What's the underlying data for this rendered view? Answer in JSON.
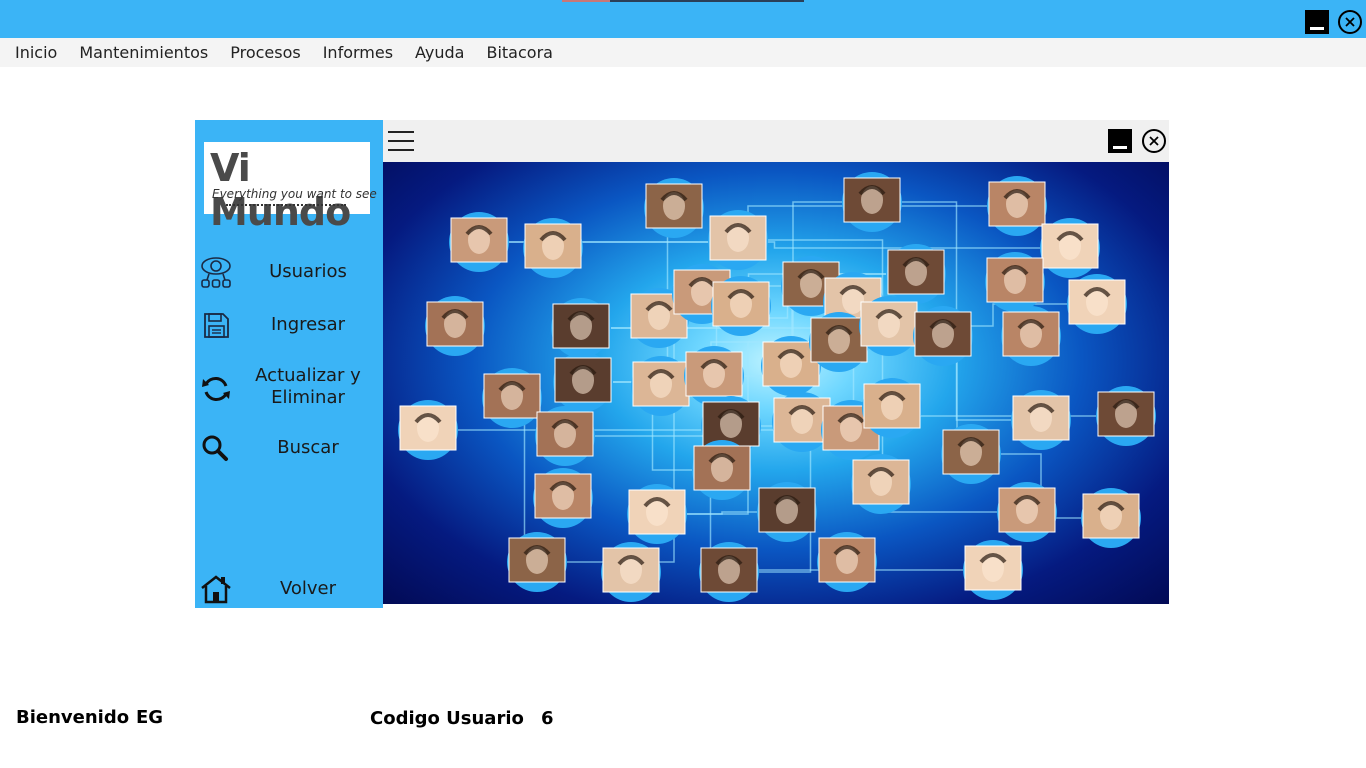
{
  "menu": [
    "Inicio",
    "Mantenimientos",
    "Procesos",
    "Informes",
    "Ayuda",
    "Bitacora"
  ],
  "logo": {
    "title": "Vi Mundo",
    "subtitle": "Everything you want to see"
  },
  "sidebar": {
    "items": [
      {
        "label": "Usuarios",
        "icon": "users-icon"
      },
      {
        "label": "Ingresar",
        "icon": "save-icon"
      },
      {
        "label_line1": "Actualizar y",
        "label_line2": "Eliminar",
        "icon": "refresh-icon"
      },
      {
        "label": "Buscar",
        "icon": "search-icon"
      },
      {
        "label": "Volver",
        "icon": "home-icon"
      }
    ]
  },
  "status": {
    "welcome_label": "Bienvenido",
    "user_name": "EG",
    "code_label": "Codigo Usuario",
    "code_value": "6"
  },
  "colors": {
    "titlebar": "#3bb4f6",
    "sidebar": "#3bb4f6",
    "menubar": "#f4f4f4",
    "network_dark": "#020a55",
    "network_light": "#6fd7ff"
  }
}
